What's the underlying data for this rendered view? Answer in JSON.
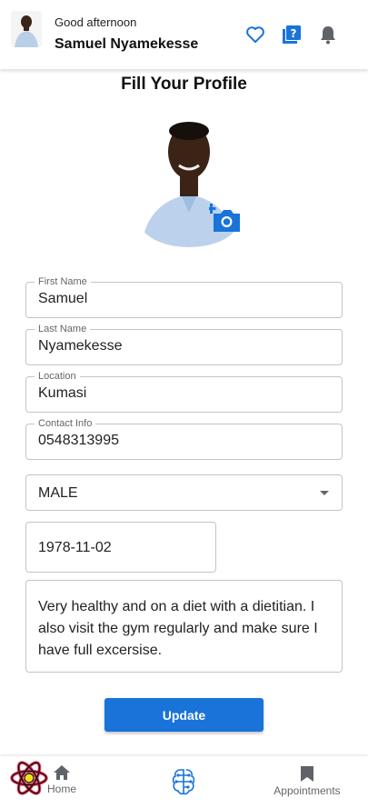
{
  "header": {
    "greeting": "Good afternoon",
    "user_name": "Samuel Nyamekesse",
    "icons": [
      "heart-icon",
      "help-book-icon",
      "bell-icon"
    ]
  },
  "page": {
    "title": "Fill Your Profile"
  },
  "form": {
    "first_name": {
      "label": "First Name",
      "value": "Samuel"
    },
    "last_name": {
      "label": "Last Name",
      "value": "Nyamekesse"
    },
    "location": {
      "label": "Location",
      "value": "Kumasi"
    },
    "contact": {
      "label": "Contact Info",
      "value": "0548313995"
    },
    "gender": {
      "value": "MALE"
    },
    "dob": {
      "value": "1978-11-02"
    },
    "bio": {
      "value": "Very healthy and on a diet with a dietitian. I also visit the gym regularly and make sure I have full excersise."
    },
    "submit_label": "Update"
  },
  "bottom_nav": {
    "home_label": "Home",
    "appointments_label": "Appointments"
  },
  "colors": {
    "accent": "#1a73d9",
    "icon_gray": "#666666"
  }
}
